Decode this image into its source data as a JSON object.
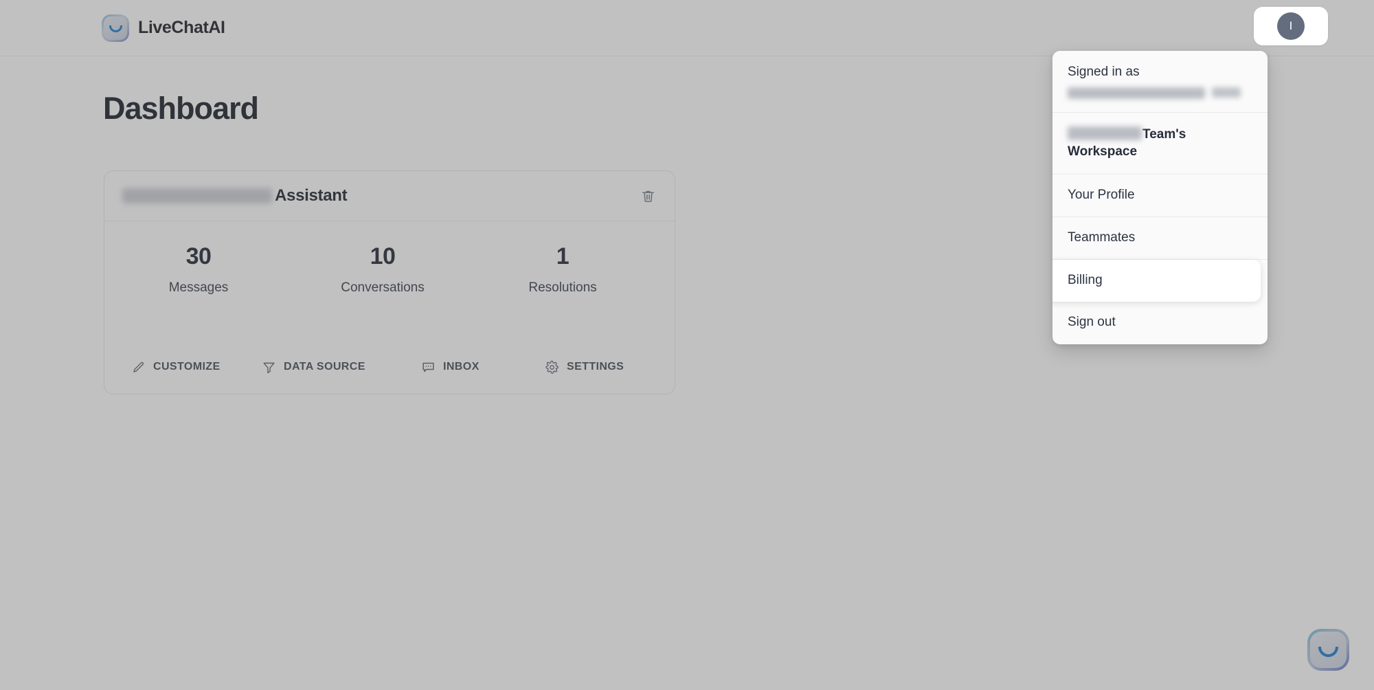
{
  "header": {
    "brand_name": "LiveChatAI",
    "logo_icon": "livechatai-smiley-logo",
    "avatar_initial": "I"
  },
  "main": {
    "page_title": "Dashboard"
  },
  "assistant_card": {
    "name_redacted": "",
    "title": "Assistant",
    "delete_icon": "trash-icon",
    "stats": [
      {
        "value": "30",
        "label": "Messages"
      },
      {
        "value": "10",
        "label": "Conversations"
      },
      {
        "value": "1",
        "label": "Resolutions"
      }
    ],
    "actions": [
      {
        "label": "CUSTOMIZE",
        "icon": "pencil-icon"
      },
      {
        "label": "DATA SOURCE",
        "icon": "funnel-icon"
      },
      {
        "label": "INBOX",
        "icon": "chat-bubble-icon"
      },
      {
        "label": "SETTINGS",
        "icon": "gear-icon"
      }
    ]
  },
  "account_menu": {
    "signed_in_label": "Signed in as",
    "signed_in_email_redacted": "",
    "workspace_name_redacted": "",
    "workspace_suffix": "Team's Workspace",
    "items": [
      {
        "label": "Your Profile",
        "highlighted": false
      },
      {
        "label": "Teammates",
        "highlighted": false
      },
      {
        "label": "Billing",
        "highlighted": true
      },
      {
        "label": "Sign out",
        "highlighted": false
      }
    ]
  },
  "chat_widget": {
    "launcher_icon": "livechatai-smiley-logo"
  },
  "colors": {
    "brand_blue": "#1273c9",
    "text_dark": "#171c2b",
    "text_body": "#2c3342",
    "avatar_bg": "#636d7e",
    "card_border": "#e4e6ea",
    "scrim": "rgba(100,100,100,0.40)"
  }
}
